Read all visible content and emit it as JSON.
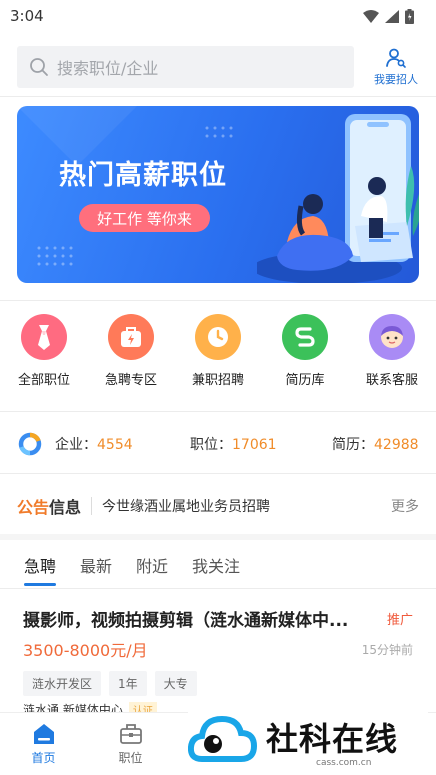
{
  "status_bar": {
    "time": "3:04"
  },
  "search": {
    "placeholder": "搜索职位/企业"
  },
  "header": {
    "recruit_label": "我要招人"
  },
  "banner": {
    "title": "热门高薪职位",
    "slogan": "好工作 等你来"
  },
  "quick_links": [
    {
      "label": "全部职位",
      "icon": "tie-icon",
      "color": "#ff6b81"
    },
    {
      "label": "急聘专区",
      "icon": "urgent-bag-icon",
      "color": "#ff7a59"
    },
    {
      "label": "兼职招聘",
      "icon": "clock-icon",
      "color": "#ffb14a"
    },
    {
      "label": "简历库",
      "icon": "resume-s-icon",
      "color": "#3cc15a"
    },
    {
      "label": "联系客服",
      "icon": "service-avatar-icon",
      "color": "#a98bf5"
    }
  ],
  "stats": {
    "company_label": "企业：",
    "company_value": "4554",
    "job_label": "职位：",
    "job_value": "17061",
    "resume_label": "简历：",
    "resume_value": "42988"
  },
  "notice": {
    "tag_part1": "公告",
    "tag_part2": "信息",
    "text": "今世缘酒业属地业务员招聘",
    "more": "更多"
  },
  "tabs": [
    {
      "label": "急聘",
      "active": true
    },
    {
      "label": "最新",
      "active": false
    },
    {
      "label": "附近",
      "active": false
    },
    {
      "label": "我关注",
      "active": false
    }
  ],
  "job": {
    "title": "摄影师，视频拍摄剪辑（涟水通新媒体中...",
    "promo": "推广",
    "salary": "3500-8000元/月",
    "time": "15分钟前",
    "tags": [
      "涟水开发区",
      "1年",
      "大专"
    ],
    "company": "涟水通 新媒体中心",
    "company_badge": "认证"
  },
  "bottom_nav": [
    {
      "label": "首页",
      "icon": "home-icon",
      "active": true
    },
    {
      "label": "职位",
      "icon": "briefcase-icon",
      "active": false
    }
  ],
  "watermark": {
    "text": "社科在线",
    "sub": "cass.com.cn"
  },
  "colors": {
    "accent": "#1f7ae0",
    "salary": "#f06a3a",
    "stat_number": "#f08c2a"
  }
}
